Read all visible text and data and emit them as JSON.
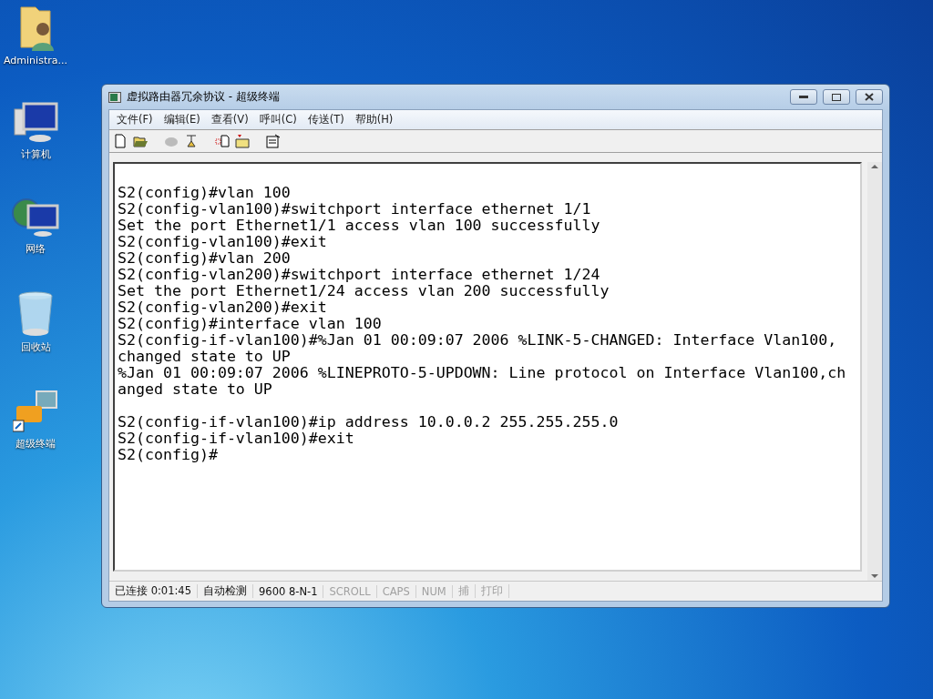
{
  "desktop_icons": [
    {
      "label": "Administra..."
    },
    {
      "label": "计算机"
    },
    {
      "label": "网络"
    },
    {
      "label": "回收站"
    },
    {
      "label": "超级终端"
    }
  ],
  "window": {
    "title": "虚拟路由器冗余协议 - 超级终端"
  },
  "menu": [
    "文件(F)",
    "编辑(E)",
    "查看(V)",
    "呼叫(C)",
    "传送(T)",
    "帮助(H)"
  ],
  "terminal": {
    "blocks": [
      [
        "S2(config)#vlan 100",
        "S2(config-vlan100)#switchport interface ethernet 1/1",
        "Set the port Ethernet1/1 access vlan 100 successfully",
        "S2(config-vlan100)#exit",
        "S2(config)#vlan 200",
        "S2(config-vlan200)#switchport interface ethernet 1/24",
        "Set the port Ethernet1/24 access vlan 200 successfully",
        "S2(config-vlan200)#exit",
        "S2(config)#interface vlan 100",
        "S2(config-if-vlan100)#%Jan 01 00:09:07 2006 %LINK-5-CHANGED: Interface Vlan100,",
        "changed state to UP",
        "%Jan 01 00:09:07 2006 %LINEPROTO-5-UPDOWN: Line protocol on Interface Vlan100,ch",
        "anged state to UP"
      ],
      [
        "S2(config-if-vlan100)#ip address 10.0.0.2 255.255.255.0",
        "S2(config-if-vlan100)#exit",
        "S2(config)#"
      ]
    ]
  },
  "status_bar": [
    {
      "text": "已连接 0:01:45",
      "disabled": false
    },
    {
      "text": "自动检测",
      "disabled": false
    },
    {
      "text": "9600 8-N-1",
      "disabled": false
    },
    {
      "text": "SCROLL",
      "disabled": true
    },
    {
      "text": "CAPS",
      "disabled": true
    },
    {
      "text": "NUM",
      "disabled": true
    },
    {
      "text": "捕",
      "disabled": true
    },
    {
      "text": "打印",
      "disabled": true
    }
  ]
}
